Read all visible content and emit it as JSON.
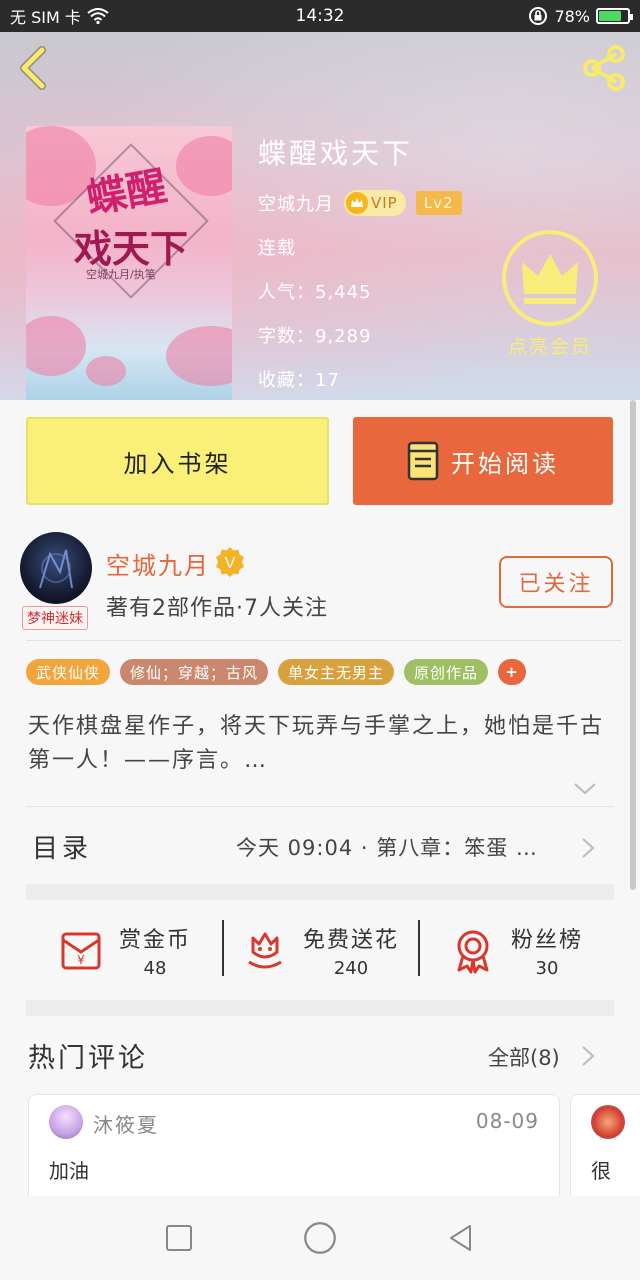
{
  "status_bar": {
    "carrier": "无 SIM 卡",
    "time": "14:32",
    "battery": "78%",
    "battery_level": 0.78
  },
  "book": {
    "title": "蝶醒戏天下",
    "cover_title_line1": "蝶醒",
    "cover_title_line2": "戏天下",
    "cover_author": "空城九月/执笔",
    "author": "空城九月",
    "vip_badge": "VIP",
    "level_badge": "Lv2",
    "status": "连载",
    "popularity": "人气：5,445",
    "word_count": "字数：9,289",
    "favorites": "收藏：17"
  },
  "vip_promo": {
    "label": "点亮会员"
  },
  "actions": {
    "add_shelf": "加入书架",
    "start_read": "开始阅读"
  },
  "author_panel": {
    "name": "空城九月",
    "verify_mark": "V",
    "meta": "著有2部作品·7人关注",
    "tag": "梦神迷妹",
    "follow_label": "已关注"
  },
  "tags": [
    {
      "label": "武侠仙侠",
      "color": "#f2a53a"
    },
    {
      "label": "修仙；穿越；古风",
      "color": "#c9876e"
    },
    {
      "label": "单女主无男主",
      "color": "#d7a13e"
    },
    {
      "label": "原创作品",
      "color": "#9ec063"
    },
    {
      "label": "+",
      "color": "#e8673c"
    }
  ],
  "description": "天作棋盘星作子，将天下玩弄与手掌之上，她怕是千古第一人！——序言。…",
  "toc": {
    "label": "目录",
    "latest": "今天 09:04 · 第八章：笨蛋 …"
  },
  "stats": [
    {
      "label": "赏金币",
      "value": "48",
      "icon": "red-envelope-icon"
    },
    {
      "label": "免费送花",
      "value": "240",
      "icon": "flower-icon"
    },
    {
      "label": "粉丝榜",
      "value": "30",
      "icon": "medal-icon"
    }
  ],
  "comments": {
    "title": "热门评论",
    "all_label": "全部(8)",
    "items": [
      {
        "user": "沐筱夏",
        "date": "08-09",
        "text": "加油"
      },
      {
        "user": "",
        "date": "",
        "text": "很"
      }
    ]
  },
  "colors": {
    "accent": "#e8673c",
    "shelf_button": "#faf078",
    "vip_gold": "#f8ec7a"
  }
}
